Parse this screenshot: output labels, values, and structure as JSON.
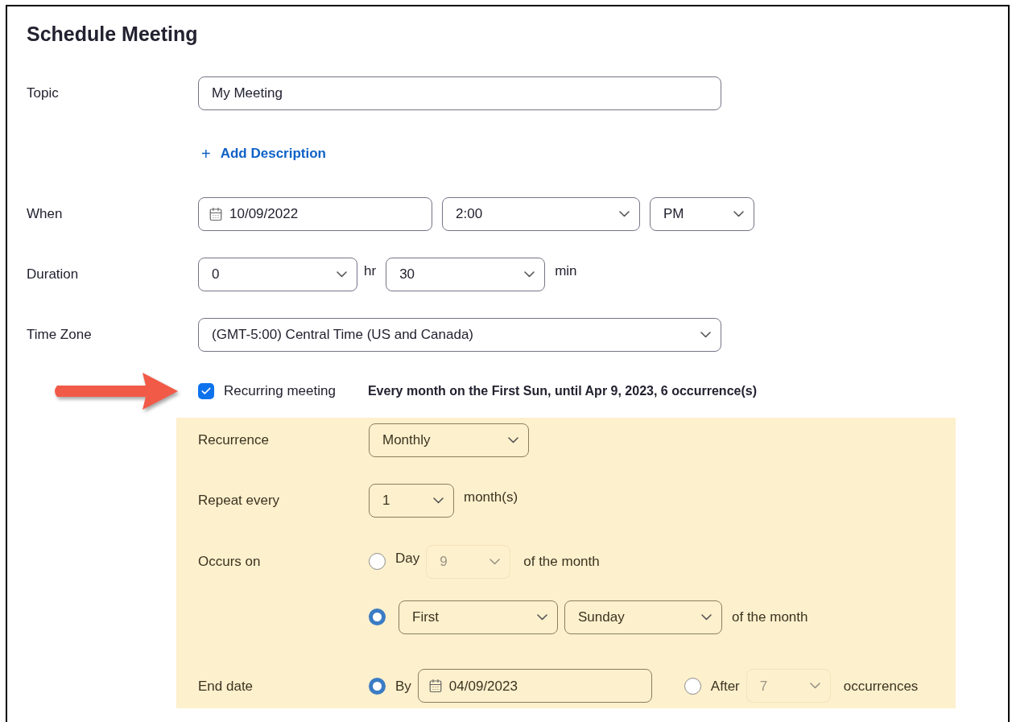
{
  "title": "Schedule Meeting",
  "topic": {
    "label": "Topic",
    "value": "My Meeting"
  },
  "add_description": {
    "icon": "+",
    "label": "Add Description"
  },
  "when": {
    "label": "When",
    "date": "10/09/2022",
    "time": "2:00",
    "period": "PM"
  },
  "duration": {
    "label": "Duration",
    "hours": "0",
    "hours_unit": "hr",
    "minutes": "30",
    "minutes_unit": "min"
  },
  "time_zone": {
    "label": "Time Zone",
    "value": "(GMT-5:00) Central Time (US and Canada)"
  },
  "recurring": {
    "label": "Recurring meeting",
    "checked": true,
    "summary": "Every month on the First Sun, until Apr 9, 2023, 6 occurrence(s)"
  },
  "recurrence": {
    "label": "Recurrence",
    "value": "Monthly"
  },
  "repeat_every": {
    "label": "Repeat every",
    "value": "1",
    "unit": "month(s)"
  },
  "occurs_on": {
    "label": "Occurs on",
    "options": [
      {
        "kind": "day",
        "selected": false,
        "prefix": "Day",
        "value": "9",
        "suffix": "of the month"
      },
      {
        "kind": "weekday",
        "selected": true,
        "week": "First",
        "day": "Sunday",
        "suffix": "of the month"
      }
    ]
  },
  "end_date": {
    "label": "End date",
    "options": [
      {
        "kind": "by",
        "selected": true,
        "prefix": "By",
        "date": "04/09/2023"
      },
      {
        "kind": "after",
        "selected": false,
        "prefix": "After",
        "value": "7",
        "suffix": "occurrences"
      }
    ]
  }
}
